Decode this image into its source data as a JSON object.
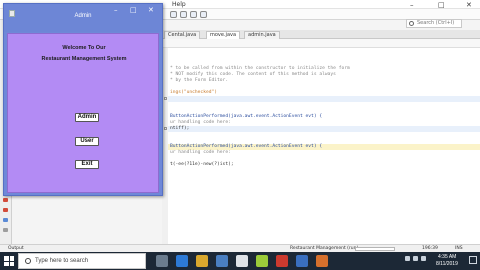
{
  "ide": {
    "menu_help": "Help",
    "search_placeholder": "Search (Ctrl+I)",
    "tabs": [
      "Cental.java",
      "move.java",
      "admin.java"
    ],
    "code_lines": [
      "* to be called from within the constructor to initialize the form",
      "* NOT modify this code. The content of this method is always",
      "* by the Form Editor.",
      "",
      "ings(\"unchecked\")",
      "",
      "",
      "",
      "ButtonActionPerformed(java.awt.event.ActionEvent evt) {",
      "ur handling code here:",
      "ntiff);",
      "",
      "",
      "ButtonActionPerformed(java.awt.event.ActionEvent evt) {",
      "ur handling code here:",
      "",
      "t(-ee(?11e)-new(?)ist);"
    ],
    "status": {
      "output": "Output",
      "project": "Restaurant Management (run)",
      "position": "196:39",
      "mode": "INS"
    }
  },
  "app": {
    "title": "Admin",
    "heading_line1": "Welcome To Our",
    "heading_line2": "Restaurant Management System",
    "buttons": {
      "admin": "Admin",
      "user": "User",
      "exit": "Exit"
    }
  },
  "taskbar": {
    "search_text": "Type here to search",
    "time": "4:35 AM",
    "date": "8/11/2019"
  },
  "colors": {
    "title_bar": "#6d86d6",
    "client_bg": "#b38bf4",
    "taskbar": "#1c2836"
  }
}
